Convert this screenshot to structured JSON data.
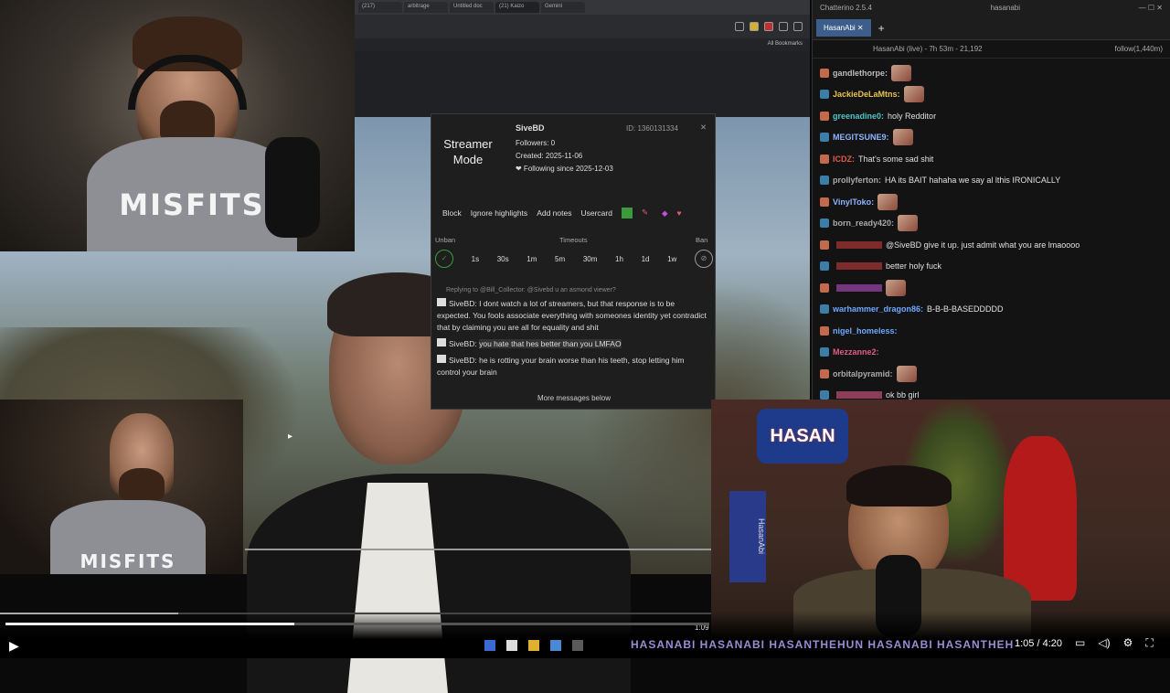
{
  "browser": {
    "tabs": [
      "(217)",
      "arbitrage",
      "Untitled doc",
      "(21) Kaizo",
      "Gemini"
    ],
    "gemini_tab": "Gemini",
    "bookmarks": "All Bookmarks"
  },
  "popup": {
    "mode_line1": "Streamer",
    "mode_line2": "Mode",
    "username": "SiveBD",
    "id": "ID: 1360131334",
    "followers": "Followers: 0",
    "created": "Created: 2025-11-06",
    "following": "❤ Following since 2025-12-03",
    "actions": {
      "block": "Block",
      "ignore": "Ignore highlights",
      "notes": "Add notes",
      "usercard": "Usercard"
    },
    "unban": "Unban",
    "timeouts": "Timeouts",
    "ban": "Ban",
    "durations": [
      "1s",
      "30s",
      "1m",
      "5m",
      "30m",
      "1h",
      "1d",
      "1w"
    ],
    "replying": "Replying to @Bill_Collector: @Sivebd u an asmond viewer?",
    "messages": [
      {
        "user": "SiveBD:",
        "text": "I dont watch a lot of streamers, but that response is to be expected. You fools associate everything with someones identity yet contradict that by claiming you are all for equality and shit"
      },
      {
        "user": "SiveBD:",
        "text": "you hate that hes better than you LMFAO"
      },
      {
        "user": "SiveBD:",
        "text": "he is rotting your brain worse than his teeth, stop letting him control your brain"
      }
    ],
    "more": "More messages below"
  },
  "chatterino": {
    "app_title": "Chatterino 2.5.4",
    "channel_top": "hasanabi",
    "tab": "HasanAbi",
    "status": "HasanAbi (live) - 7h 53m - 21,192",
    "follow": "follow(1,440m)",
    "messages": [
      {
        "user": "gandlethorpe:",
        "text": "",
        "emote": true,
        "color": "#bbb"
      },
      {
        "user": "JackieDeLaMtns:",
        "text": "",
        "emote": true,
        "color": "#e6c44a"
      },
      {
        "user": "greenadine0:",
        "text": "holy Redditor",
        "emote": false,
        "color": "#4fc3c6"
      },
      {
        "user": "MEGITSUNE9:",
        "text": "",
        "emote": true,
        "color": "#8fb4ff"
      },
      {
        "user": "ICDZ:",
        "text": "That's some sad shit",
        "emote": false,
        "color": "#e05c4c"
      },
      {
        "user": "prollyferton:",
        "text": "HA its BAIT hahaha we say al lthis IRONICALLY",
        "emote": false,
        "color": "#aaa"
      },
      {
        "user": "VinylToko:",
        "text": "",
        "emote": true,
        "color": "#8fb4ff"
      },
      {
        "user": "born_ready420:",
        "text": "",
        "emote": true,
        "color": "#aaa"
      },
      {
        "user": "",
        "text": "@SiveBD give it up. just admit what you are lmaoooo",
        "emote": false,
        "color": "#c83c3c"
      },
      {
        "user": "",
        "text": "better holy fuck",
        "emote": false,
        "color": "#c83c3c"
      },
      {
        "user": "",
        "text": "",
        "emote": true,
        "color": "#b44ec8"
      },
      {
        "user": "warhammer_dragon86:",
        "text": "B-B-B-BASEDDDDD",
        "emote": false,
        "color": "#6fa8ff"
      },
      {
        "user": "nigel_homeless:",
        "text": "",
        "emote": false,
        "color": "#6fa8ff"
      },
      {
        "user": "Mezzanne2:",
        "text": "",
        "emote": false,
        "color": "#e05c8c"
      },
      {
        "user": "orbitalpyramid:",
        "text": "",
        "emote": true,
        "color": "#aaa"
      },
      {
        "user": "",
        "text": "ok bb girl",
        "emote": false,
        "color": "#e05c8c"
      }
    ]
  },
  "cam": {
    "shirt": "MISFITS",
    "shirt2": "MISFITS"
  },
  "room": {
    "sign": "HASAN",
    "banner": "HasanAbi"
  },
  "player": {
    "inner_time": "1:09",
    "time": "1:05 / 4:20",
    "ticker": "HASANABI   HASANABI   HASANTHEHUN   HASANABI   HASANTHEHUN",
    "progress": 0.25,
    "inner_progress": 0.41
  }
}
